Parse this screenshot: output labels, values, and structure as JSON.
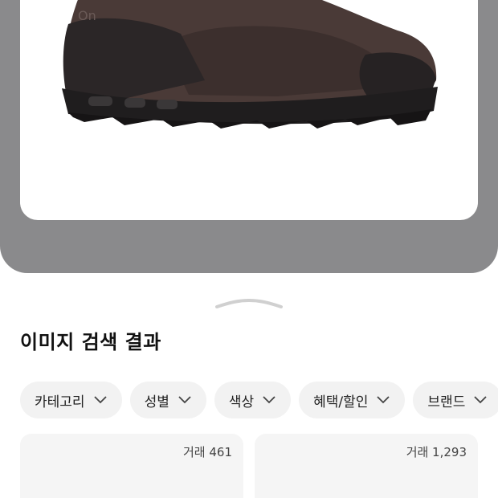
{
  "search_image": {
    "icon": "sneaker-image"
  },
  "sheet": {
    "title": "이미지 검색 결과",
    "filters": [
      {
        "label": "카테고리"
      },
      {
        "label": "성별"
      },
      {
        "label": "색상"
      },
      {
        "label": "혜택/할인"
      },
      {
        "label": "브랜드"
      }
    ],
    "results": [
      {
        "trade_count": "거래 461"
      },
      {
        "trade_count": "거래 1,293"
      }
    ]
  },
  "colors": {
    "frame": "#8a8a8c",
    "chip_bg": "#f2f2f2",
    "card_bg": "#f5f5f5",
    "shoe_upper": "#4a3a37",
    "shoe_sole": "#1f1d1e"
  }
}
